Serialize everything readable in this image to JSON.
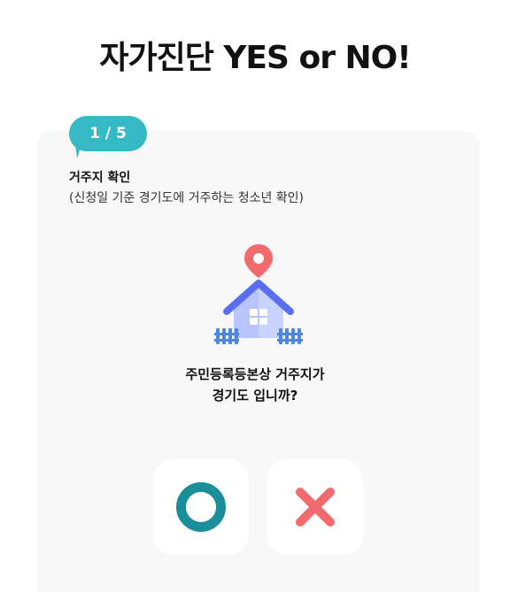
{
  "header": {
    "title": "자가진단 YES or NO!"
  },
  "step": {
    "counter": "1 / 5",
    "title": "거주지 확인",
    "subtitle": "(신청일 기준 경기도에 거주하는 청소년 확인)"
  },
  "question": {
    "line1": "주민등록등본상 거주지가",
    "line2": "경기도 입니까?"
  },
  "answers": {
    "yes_icon": "circle-o-icon",
    "no_icon": "x-icon"
  },
  "colors": {
    "badge": "#35b9c5",
    "card_bg": "#f8f8f8",
    "yes": "#1a8f9a",
    "no": "#f2696e",
    "house_roof": "#5a6ef0",
    "house_body": "#b7c4ff",
    "pin": "#f2696e",
    "fence": "#4f86e0"
  }
}
